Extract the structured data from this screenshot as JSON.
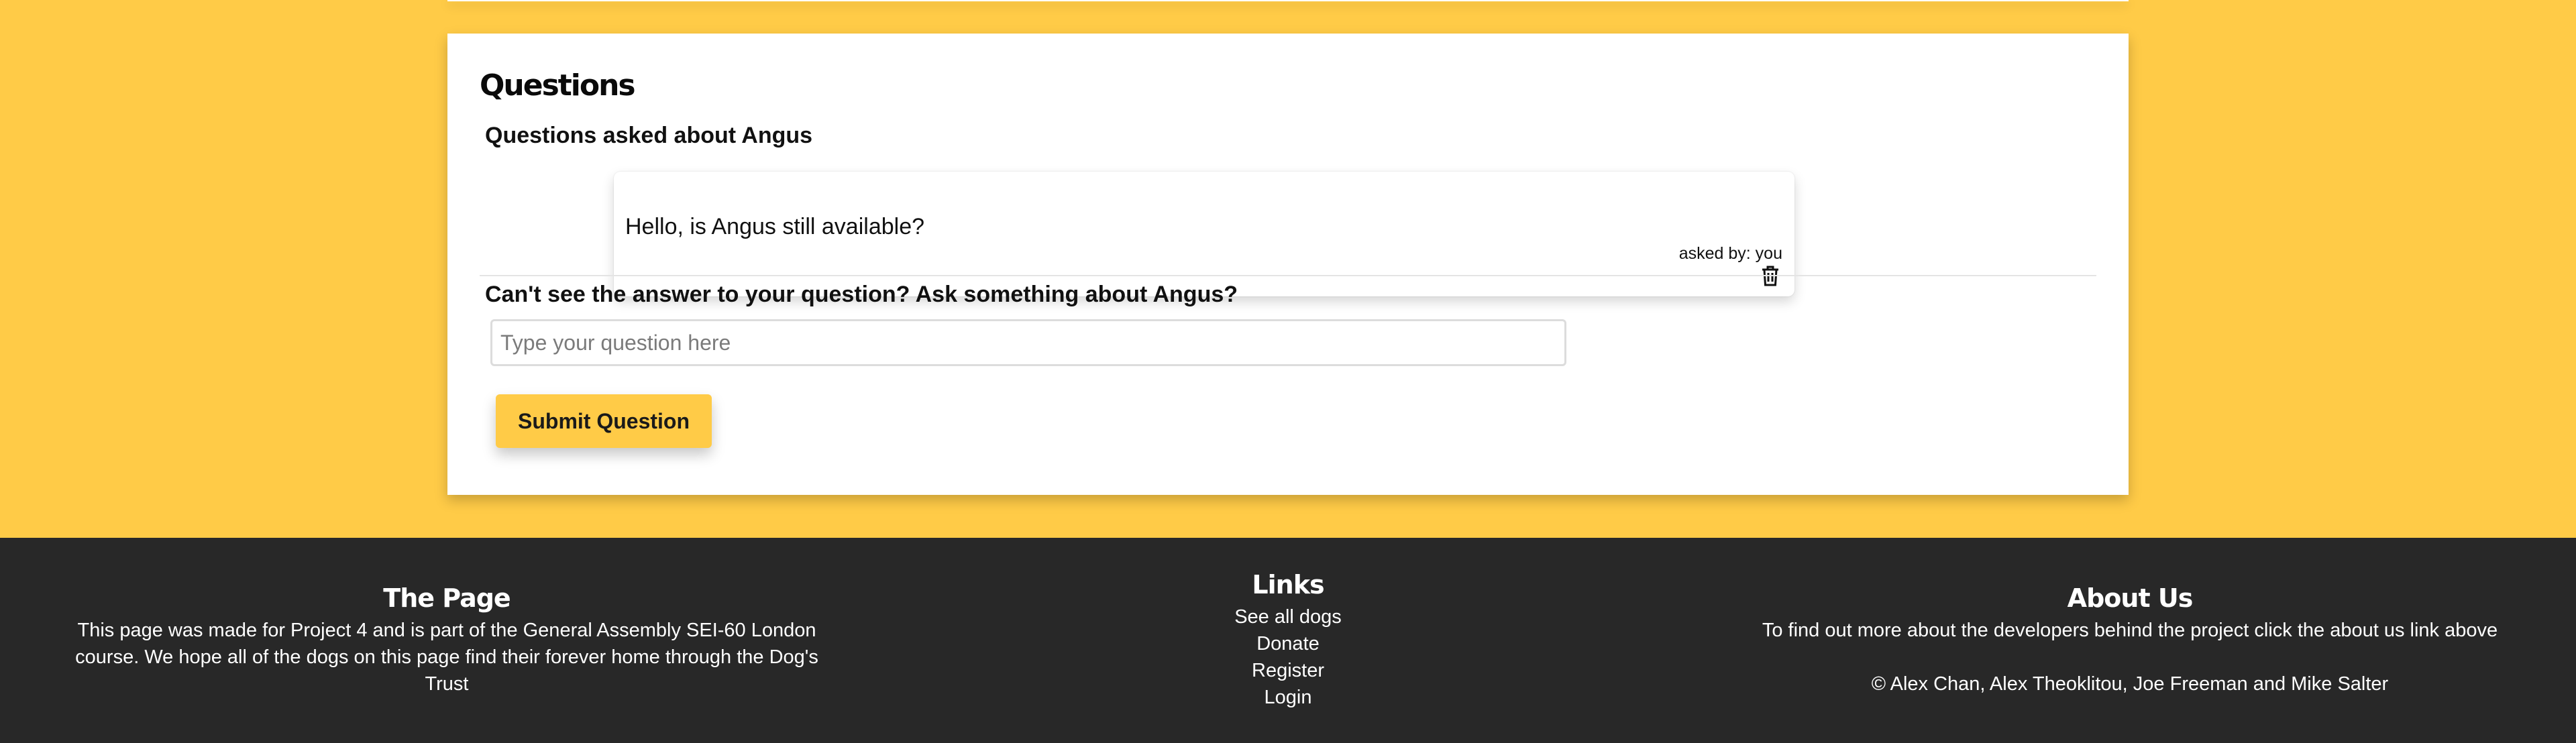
{
  "questions": {
    "title": "Questions",
    "subtitle": "Questions asked about Angus",
    "items": [
      {
        "text": "Hello, is Angus still available?",
        "asked_by": "asked by: you",
        "icon": "trash-icon"
      }
    ],
    "ask_title": "Can't see the answer to your question? Ask something about Angus?",
    "input_placeholder": "Type your question here",
    "submit_label": "Submit Question"
  },
  "footer": {
    "page": {
      "heading": "The Page",
      "text": "This page was made for Project 4 and is part of the General Assembly SEI-60 London course. We hope all of the dogs on this page find their forever home through the Dog's Trust"
    },
    "links": {
      "heading": "Links",
      "items": [
        "See all dogs",
        "Donate",
        "Register",
        "Login"
      ]
    },
    "about": {
      "heading": "About Us",
      "text": "To find out more about the developers behind the project click the about us link above",
      "copyright": "© Alex Chan, Alex Theoklitou, Joe Freeman and Mike Salter"
    }
  },
  "colors": {
    "background": "#ffcb47",
    "footer": "#282828",
    "button": "#ffcb47"
  }
}
